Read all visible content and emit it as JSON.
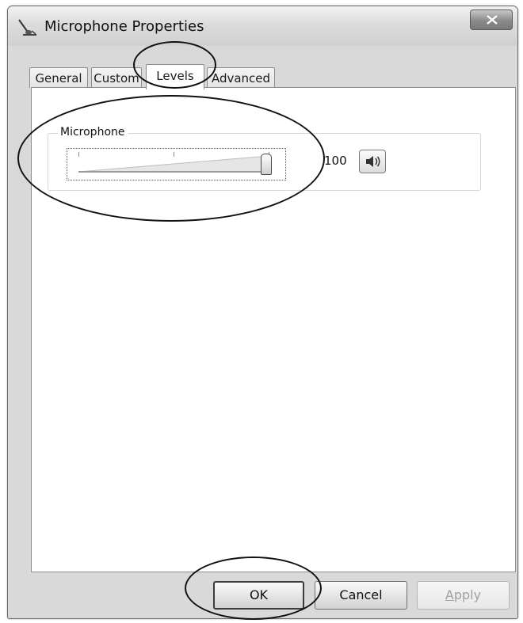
{
  "window": {
    "title": "Microphone Properties",
    "icon": "microphone-icon",
    "close_icon": "close-icon"
  },
  "tabs": [
    {
      "label": "General",
      "active": false
    },
    {
      "label": "Custom",
      "active": false
    },
    {
      "label": "Levels",
      "active": true
    },
    {
      "label": "Advanced",
      "active": false
    }
  ],
  "levels": {
    "group_label": "Microphone",
    "slider_level": 1.0,
    "value": "100",
    "mute_icon": "speaker-icon"
  },
  "buttons": {
    "ok": "OK",
    "cancel": "Cancel",
    "apply_prefix": "",
    "apply_accel": "A",
    "apply_rest": "pply"
  }
}
